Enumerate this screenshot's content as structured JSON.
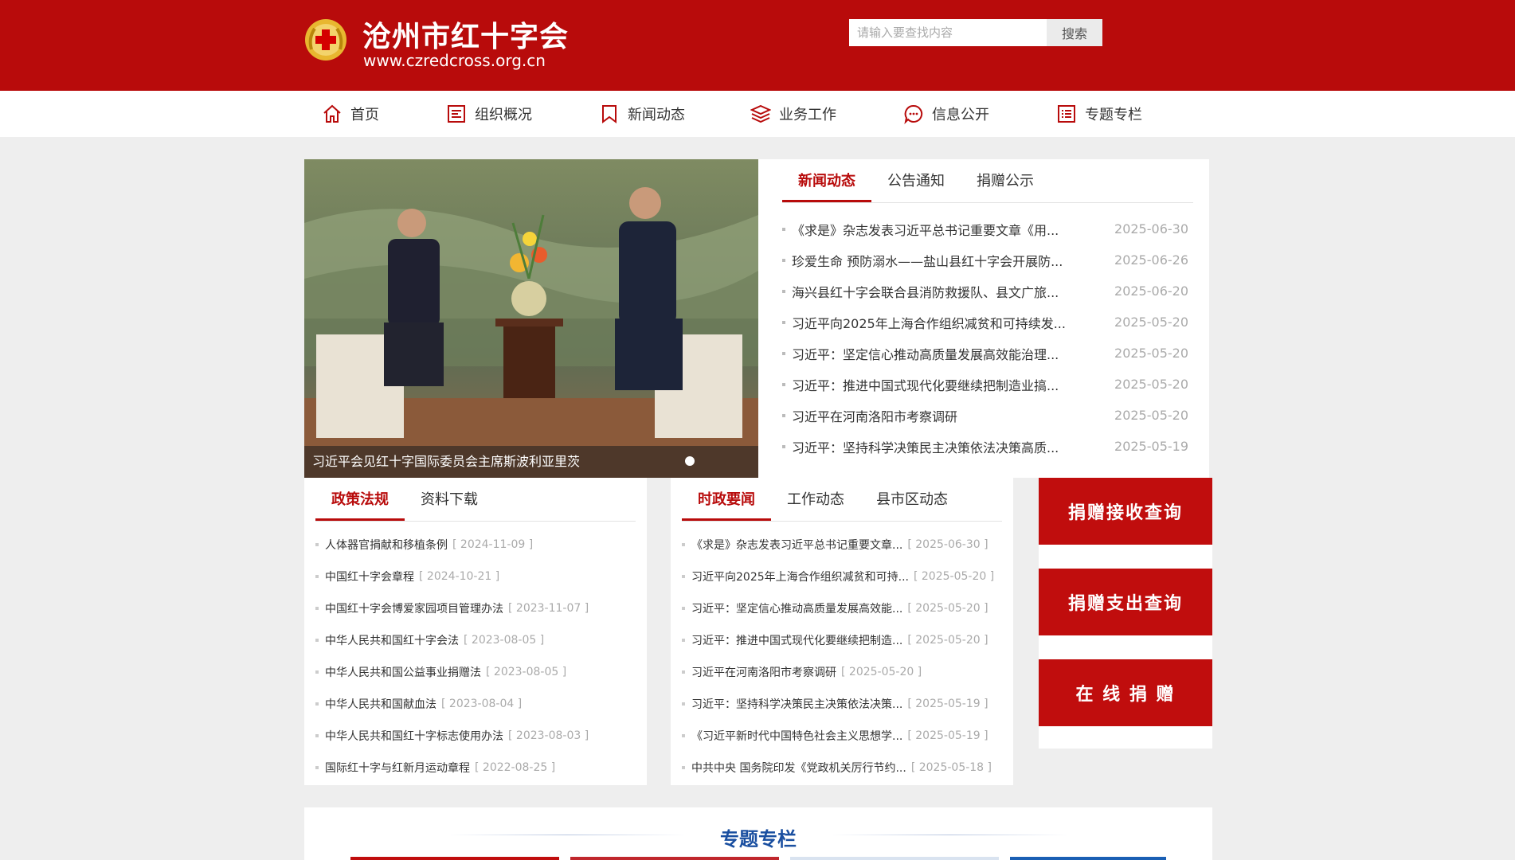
{
  "header": {
    "title": "沧州市红十字会",
    "url": "www.czredcross.org.cn",
    "search_placeholder": "请输入要查找内容",
    "search_button": "搜索"
  },
  "nav": {
    "items": [
      {
        "label": "首页",
        "icon": "home-icon"
      },
      {
        "label": "组织概况",
        "icon": "document-icon"
      },
      {
        "label": "新闻动态",
        "icon": "bookmark-icon"
      },
      {
        "label": "业务工作",
        "icon": "layers-icon"
      },
      {
        "label": "信息公开",
        "icon": "chat-icon"
      },
      {
        "label": "专题专栏",
        "icon": "list-icon"
      }
    ]
  },
  "slider": {
    "caption": "习近平会见红十字国际委员会主席斯波利亚里茨"
  },
  "news": {
    "tabs": [
      "新闻动态",
      "公告通知",
      "捐赠公示"
    ],
    "items": [
      {
        "title": "《求是》杂志发表习近平总书记重要文章《用...",
        "date": "2025-06-30"
      },
      {
        "title": "珍爱生命 预防溺水——盐山县红十字会开展防...",
        "date": "2025-06-26"
      },
      {
        "title": "海兴县红十字会联合县消防救援队、县文广旅...",
        "date": "2025-06-20"
      },
      {
        "title": "习近平向2025年上海合作组织减贫和可持续发...",
        "date": "2025-05-20"
      },
      {
        "title": "习近平：坚定信心推动高质量发展高效能治理...",
        "date": "2025-05-20"
      },
      {
        "title": "习近平：推进中国式现代化要继续把制造业搞...",
        "date": "2025-05-20"
      },
      {
        "title": "习近平在河南洛阳市考察调研",
        "date": "2025-05-20"
      },
      {
        "title": "习近平：坚持科学决策民主决策依法决策高质...",
        "date": "2025-05-19"
      }
    ]
  },
  "policy": {
    "tabs": [
      "政策法规",
      "资料下载"
    ],
    "items": [
      {
        "title": "人体器官捐献和移植条例",
        "date": "[ 2024-11-09 ]"
      },
      {
        "title": "中国红十字会章程",
        "date": "[ 2024-10-21 ]"
      },
      {
        "title": "中国红十字会博爱家园项目管理办法",
        "date": "[ 2023-11-07 ]"
      },
      {
        "title": "中华人民共和国红十字会法",
        "date": "[ 2023-08-05 ]"
      },
      {
        "title": "中华人民共和国公益事业捐赠法",
        "date": "[ 2023-08-05 ]"
      },
      {
        "title": "中华人民共和国献血法",
        "date": "[ 2023-08-04 ]"
      },
      {
        "title": "中华人民共和国红十字标志使用办法",
        "date": "[ 2023-08-03 ]"
      },
      {
        "title": "国际红十字与红新月运动章程",
        "date": "[ 2022-08-25 ]"
      }
    ]
  },
  "politics": {
    "tabs": [
      "时政要闻",
      "工作动态",
      "县市区动态"
    ],
    "items": [
      {
        "title": "《求是》杂志发表习近平总书记重要文章...",
        "date": "[ 2025-06-30 ]"
      },
      {
        "title": "习近平向2025年上海合作组织减贫和可持...",
        "date": "[ 2025-05-20 ]"
      },
      {
        "title": "习近平：坚定信心推动高质量发展高效能...",
        "date": "[ 2025-05-20 ]"
      },
      {
        "title": "习近平：推进中国式现代化要继续把制造...",
        "date": "[ 2025-05-20 ]"
      },
      {
        "title": "习近平在河南洛阳市考察调研",
        "date": "[ 2025-05-20 ]"
      },
      {
        "title": "习近平：坚持科学决策民主决策依法决策...",
        "date": "[ 2025-05-19 ]"
      },
      {
        "title": "《习近平新时代中国特色社会主义思想学...",
        "date": "[ 2025-05-19 ]"
      },
      {
        "title": "中共中央 国务院印发《党政机关厉行节约...",
        "date": "[ 2025-05-18 ]"
      }
    ]
  },
  "side_buttons": [
    "捐赠接收查询",
    "捐赠支出查询",
    "在 线 捐 赠"
  ],
  "special": {
    "title": "专题专栏"
  },
  "colors": {
    "brand_red": "#b80b0b",
    "accent_blue": "#1a4fa0"
  }
}
